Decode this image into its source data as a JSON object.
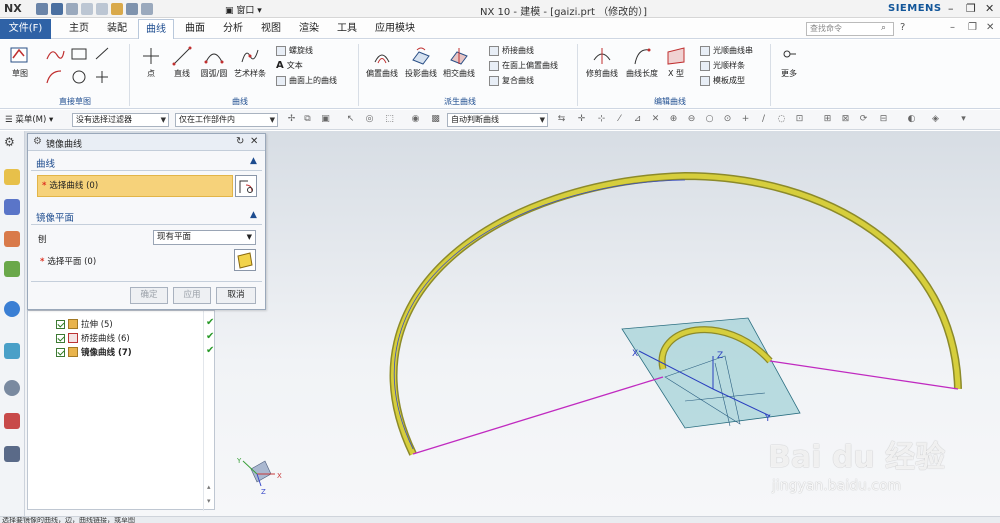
{
  "app": {
    "logo": "NX",
    "title": "NX 10 - 建模 - [gaizi.prt （修改的）]",
    "brand": "SIEMENS",
    "window_menu": "窗口"
  },
  "tabs": {
    "file": "文件(F)",
    "items": [
      "主页",
      "装配",
      "曲线",
      "曲面",
      "分析",
      "视图",
      "渲染",
      "工具",
      "应用模块"
    ],
    "active": "曲线",
    "search_placeholder": "查找命令"
  },
  "ribbon": {
    "sketch": "草图",
    "direct_sketch_group": "直接草图",
    "point": "点",
    "line": "直线",
    "arc": "圆弧/圆",
    "spline": "艺术样条",
    "helix": "螺旋线",
    "text": "文本",
    "curve_on_face": "曲面上的曲线",
    "curve_group": "曲线",
    "offset_curve": "偏置曲线",
    "project_curve": "投影曲线",
    "intersect_curve": "相交曲线",
    "bridge_curve": "桥接曲线",
    "offset_on_face": "在面上偏置曲线",
    "composite_curve": "复合曲线",
    "derived_group": "派生曲线",
    "trim_curve": "修剪曲线",
    "curve_length": "曲线长度",
    "x_form": "X 型",
    "smooth_string": "光顺曲线串",
    "smooth_spline": "光顺样条",
    "template_shape": "模板成型",
    "edit_group": "编辑曲线",
    "more": "更多"
  },
  "toolbar": {
    "menu": "菜单(M)",
    "filter": "没有选择过滤器",
    "scope": "仅在工作部件内",
    "curve_rule": "自动判断曲线"
  },
  "dialog": {
    "title": "镜像曲线",
    "section_curve": "曲线",
    "select_curve": "选择曲线 (0)",
    "section_plane": "镜像平面",
    "plane_label": "刨",
    "plane_value": "现有平面",
    "select_plane": "选择平面 (0)",
    "ok": "确定",
    "apply": "应用",
    "cancel": "取消"
  },
  "navigator": {
    "items": [
      {
        "label": "拉伸 (5)"
      },
      {
        "label": "桥接曲线 (6)"
      },
      {
        "label": "镜像曲线 (7)"
      }
    ]
  },
  "status": {
    "text": "选择要镜像的曲线，边，曲线链接，或草图"
  },
  "watermark": {
    "brand": "Bai du 经验",
    "url": "jingyan.baidu.com"
  },
  "axes": {
    "x": "X",
    "y": "Y",
    "z": "Z"
  },
  "colors": {
    "accent": "#2f62a6",
    "highlight": "#f6d27a",
    "surface": "#c9c13a",
    "line": "#c02ac0",
    "plane": "#9fd0d6"
  }
}
